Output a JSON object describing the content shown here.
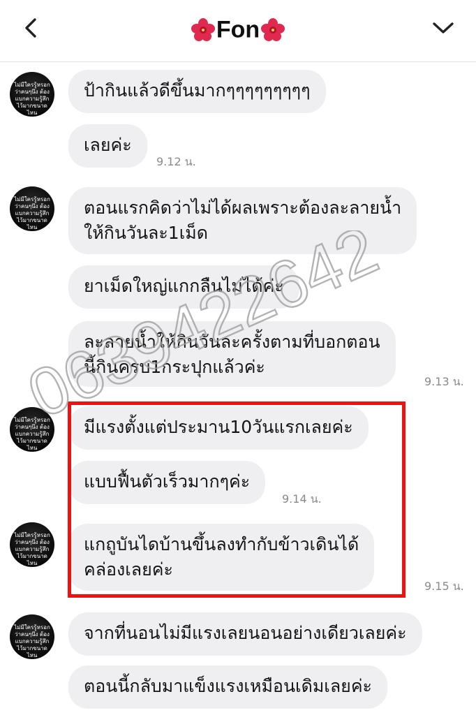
{
  "header": {
    "contact_name": "Fon",
    "back_icon": "chevron-left-icon",
    "menu_icon": "chevron-down-icon",
    "flower_icon": "hibiscus-icon"
  },
  "avatar": {
    "text": "ไม่มีใครรู้หรอก ว่าคนๆนึง ต้องแบกความรู้สึก ไว้มากขนาดไหน"
  },
  "messages": [
    {
      "text": "ป้ากินแล้วดีขึ้นมากๆๆๆๆๆๆๆๆๆ"
    },
    {
      "text": "เลยค่ะ",
      "time": "9.12 น."
    },
    {
      "line1": "ตอนแรกคิดว่าไม่ได้ผลเพราะต้องละลายน้ำ",
      "line2": "ให้กินวันละ1เม็ด"
    },
    {
      "text": "ยาเม็ดใหญ่แกกลืนไม่ได้ค่ะ"
    },
    {
      "line1": "ละลายน้ำให้กินวันละครั้งตามที่บอกตอน",
      "line2": "นี้กินครบ1กระปุกแล้วค่ะ",
      "time": "9.13 น."
    },
    {
      "text": "มีแรงตั้งแต่ประมาน10วันแรกเลยค่ะ"
    },
    {
      "text": "แบบฟื้นตัวเร็วมากๆค่ะ",
      "time": "9.14 น."
    },
    {
      "line1": "แกถูบันไดบ้านขึ้นลงทำกับข้าวเดินได้",
      "line2": "คล่องเลยค่ะ",
      "time": "9.15 น."
    },
    {
      "text": "จากที่นอนไม่มีแรงเลยนอนอย่างเดียวเลยค่ะ"
    },
    {
      "text": "ตอนนี้กลับมาแข็งแรงเหมือนเดิมเลยค่ะ"
    }
  ],
  "watermark": {
    "text": "0639422642",
    "color": "#9a9a9a"
  },
  "highlight_color": "#ee1111"
}
